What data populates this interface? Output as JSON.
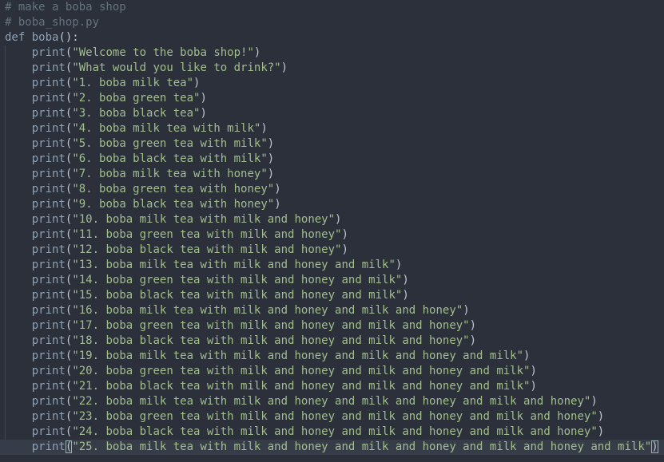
{
  "editor": {
    "comments": [
      "# make a boba shop",
      "# boba_shop.py"
    ],
    "def_keyword": "def",
    "function_name": "boba",
    "call_name": "print",
    "strings": [
      "\"Welcome to the boba shop!\"",
      "\"What would you like to drink?\"",
      "\"1. boba milk tea\"",
      "\"2. boba green tea\"",
      "\"3. boba black tea\"",
      "\"4. boba milk tea with milk\"",
      "\"5. boba green tea with milk\"",
      "\"6. boba black tea with milk\"",
      "\"7. boba milk tea with honey\"",
      "\"8. boba green tea with honey\"",
      "\"9. boba black tea with honey\"",
      "\"10. boba milk tea with milk and honey\"",
      "\"11. boba green tea with milk and honey\"",
      "\"12. boba black tea with milk and honey\"",
      "\"13. boba milk tea with milk and honey and milk\"",
      "\"14. boba green tea with milk and honey and milk\"",
      "\"15. boba black tea with milk and honey and milk\"",
      "\"16. boba milk tea with milk and honey and milk and honey\"",
      "\"17. boba green tea with milk and honey and milk and honey\"",
      "\"18. boba black tea with milk and honey and milk and honey\"",
      "\"19. boba milk tea with milk and honey and milk and honey and milk\"",
      "\"20. boba green tea with milk and honey and milk and honey and milk\"",
      "\"21. boba black tea with milk and honey and milk and honey and milk\"",
      "\"22. boba milk tea with milk and honey and milk and honey and milk and honey\"",
      "\"23. boba green tea with milk and honey and milk and honey and milk and honey\"",
      "\"24. boba black tea with milk and honey and milk and honey and milk and honey\"",
      "\"25. boba milk tea with milk and honey and milk and honey and milk and honey and milk\""
    ]
  }
}
